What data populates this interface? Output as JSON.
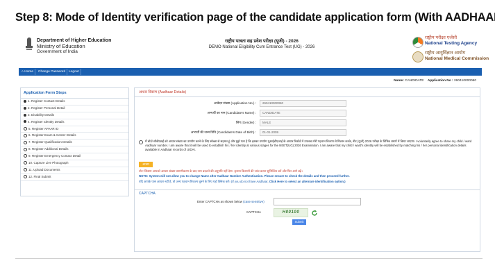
{
  "step_title": "Step 8: Mode of Identity verification page of the candidate application form (With AADHAAR)",
  "header": {
    "dept_line1": "Department of Higher Education",
    "dept_line2": "Ministry of Education",
    "dept_line3": "Government of India",
    "center_hindi": "राष्ट्रीय पात्रता सह प्रवेश परीक्षा (यूजी) - 2026",
    "center_english": "DEMO National Eligibility Cum Entrance Test (UG) - 2026",
    "nta_hindi": "राष्ट्रीय परीक्षा एजेंसी",
    "nta_english": "National Testing Agency",
    "nmc_hindi": "राष्ट्रीय आयुर्विज्ञान आयोग",
    "nmc_english": "National Medical Commission"
  },
  "nav": {
    "home": "Home",
    "change_password": "Change Password",
    "logout": "Logout"
  },
  "namebar": {
    "name_label": "Name:",
    "name_value": "CANDIDATE",
    "app_label": "Application No :",
    "app_value": "260410000060"
  },
  "sidebar": {
    "title": "Application Form Steps",
    "items": [
      {
        "label": "1. Register Contact Details",
        "done": true
      },
      {
        "label": "2. Register Personal Detail",
        "done": true
      },
      {
        "label": "3. Disability Details",
        "done": true
      },
      {
        "label": "4. Register Identity Details",
        "done": true
      },
      {
        "label": "5. Register APAAR ID",
        "done": false
      },
      {
        "label": "6. Register Exam & Center Details",
        "done": false
      },
      {
        "label": "7. Register Qualification Details",
        "done": false
      },
      {
        "label": "8. Register Additional Details",
        "done": false
      },
      {
        "label": "9. Register Emergency Contact Detail",
        "done": false
      },
      {
        "label": "10. Capture Live Photograph",
        "done": false
      },
      {
        "label": "11. Upload Documents",
        "done": false
      },
      {
        "label": "12. Final Submit",
        "done": false
      }
    ]
  },
  "aadhaar": {
    "heading": "आधार विवरण (Aadhaar Details)",
    "fields": [
      {
        "label": "आवेदन संख्या (Application No.) :",
        "value": "260410000060"
      },
      {
        "label": "अभ्यर्थी का नाम (Candidate's Name) :",
        "value": "CANDIDATE"
      },
      {
        "label": "लिंग (Gender) :",
        "value": "MALE"
      },
      {
        "label": "अभ्यर्थी की जन्म तिथि (Candidate's Date of Birth) :",
        "value": "01-01-2009"
      }
    ],
    "consent": "मैं बोर्ड/ सीबीएसई को आधार संख्या का उपयोग करने के लिए स्वेच्छा से सहमत हूं और मुझे पता है कि इसका उपयोग यूआईडीएआई के आधार रिकॉर्ड में उपलब्ध मेरी पहचान विवरण से मिलान करके, नीट (यूजी) 2026 परीक्षा के विभिन्न चरणों में किया जाएगा। I voluntarily agree to share my child / ward Aadhaar number. I am aware that it will be used to establish his / her identity at various stages for the NEET(UG) 2026 Examination. I am aware that my child / ward's identity will be established by matching his / her personal identification details available in Aadhaar records of UIDAI.",
    "button": "आधार प्रमाणित",
    "note_hindi": "नोट: सिस्टम आपको आधार संख्या प्रमाणीकरण के बाद नाम बदलने की अनुमति नहीं देगा। कृपया विवरणों की जांच करना सुनिश्चित करें और फिर आगे बढ़ें।",
    "note_english": "NOTE: System will not allow you to change Name after Aadhaar Number Authentication. Please ensure to check the details and then proceed further.",
    "alt_hindi": "यदि आपके पास आधार नहीं है, तो अन्य पहचान विकल्प चुनने के लिए यहाँ क्लिक करें। (If you do not have Aadhaar,",
    "alt_link": "Click Here to select an alternate identification option.)"
  },
  "captcha": {
    "heading": "CAPTCHA",
    "enter_label": "Enter CAPTCHA as shown below",
    "hint": "(case sensitive)",
    "captcha_label": "CAPTCHA",
    "code": "H00100",
    "submit": "Submit"
  }
}
